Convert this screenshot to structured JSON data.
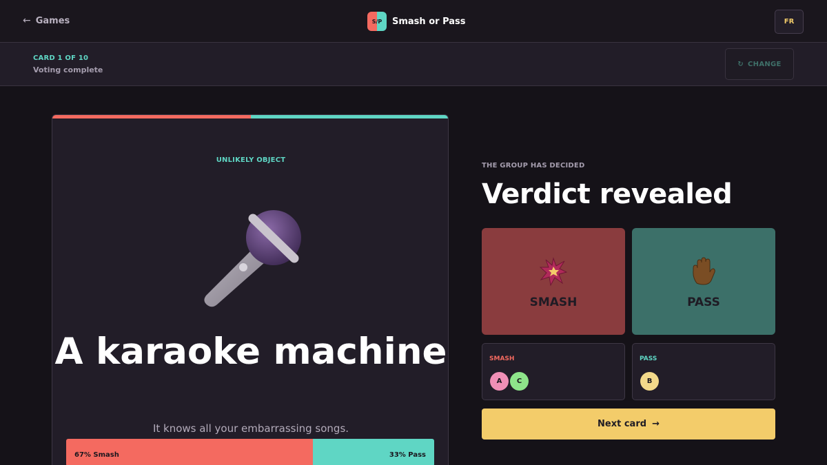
{
  "header": {
    "back_label": "Games",
    "back_arrow": "←",
    "logo_text": "S/P",
    "app_name": "Smash or Pass",
    "lang_label": "FR"
  },
  "status": {
    "card_counter": "CARD 1 OF 10",
    "voting_status": "Voting complete",
    "change_icon": "↻",
    "change_label": "CHANGE"
  },
  "card": {
    "category": "UNLIKELY OBJECT",
    "icon": "microphone-icon",
    "title": "A karaoke machine",
    "description": "It knows all your embarrassing songs.",
    "result": {
      "smash_label": "67% Smash",
      "pass_label": "33% Pass",
      "smash_fraction": 0.67
    }
  },
  "verdict": {
    "eyebrow": "THE GROUP HAS DECIDED",
    "title": "Verdict revealed",
    "smash_choice": {
      "label": "SMASH",
      "icon": "explosion-icon"
    },
    "pass_choice": {
      "label": "PASS",
      "icon": "raised-hand-icon"
    },
    "smash_voters": {
      "label": "SMASH",
      "avatars": [
        "A",
        "C"
      ]
    },
    "pass_voters": {
      "label": "PASS",
      "avatars": [
        "B"
      ]
    },
    "next_label": "Next card",
    "next_arrow": "→"
  },
  "colors": {
    "smash": "#f46a60",
    "pass": "#5fd6c4",
    "accent": "#f3cc6a",
    "avatar_a": "#f08fb6",
    "avatar_b": "#f3d98a",
    "avatar_c": "#8ee48a"
  }
}
